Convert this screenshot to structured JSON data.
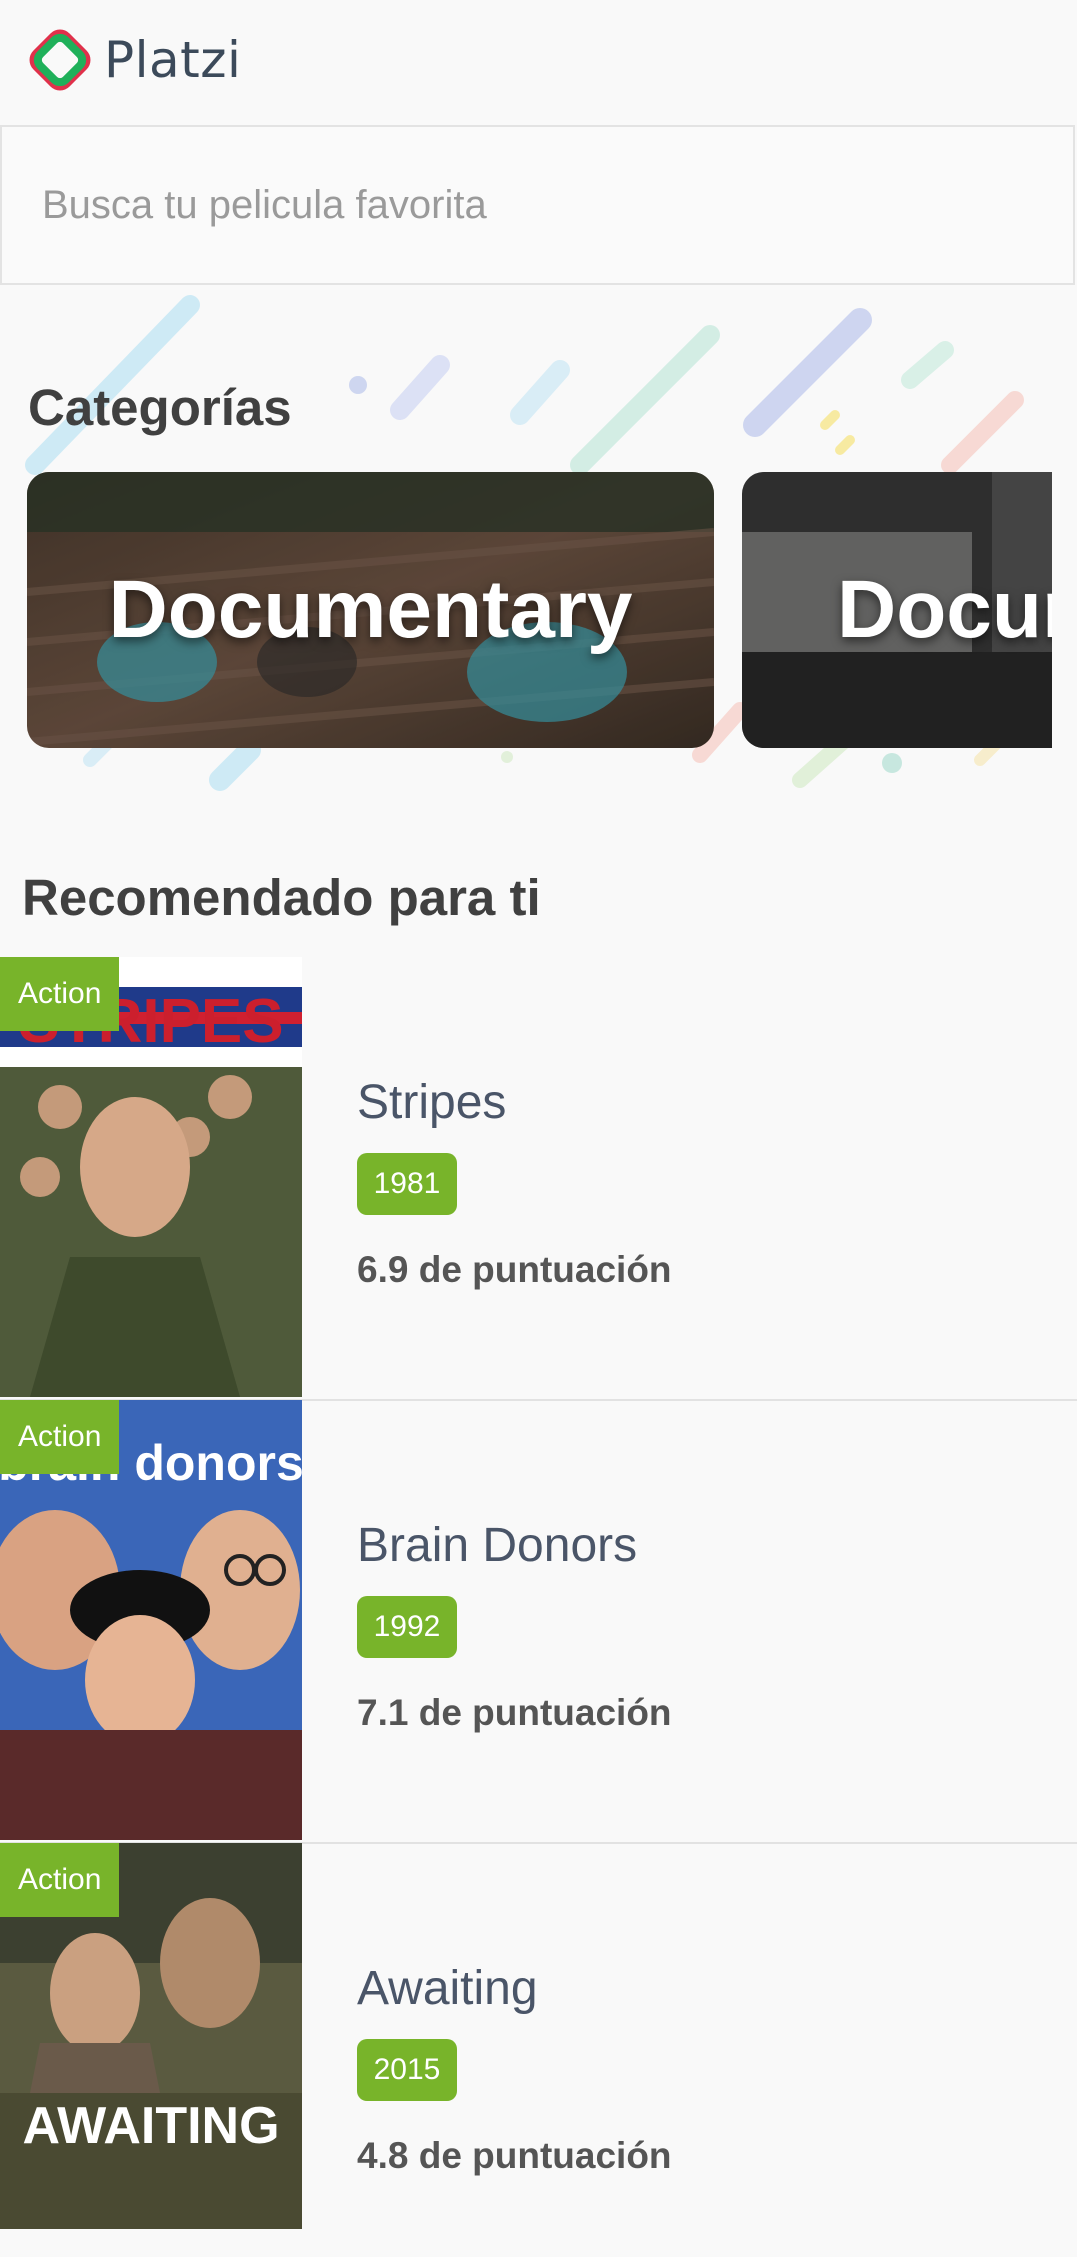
{
  "header": {
    "brand": "Platzi"
  },
  "search": {
    "placeholder": "Busca tu pelicula favorita"
  },
  "categories": {
    "title": "Categorías",
    "items": [
      {
        "label": "Documentary"
      },
      {
        "label": "Docur"
      }
    ]
  },
  "recommended": {
    "title": "Recomendado para ti",
    "movies": [
      {
        "genre": "Action",
        "title": "Stripes",
        "year": "1981",
        "score": "6.9 de puntuación",
        "poster_text": "STRIPES"
      },
      {
        "genre": "Action",
        "title": "Brain Donors",
        "year": "1992",
        "score": "7.1 de puntuación",
        "poster_text": "brain donors"
      },
      {
        "genre": "Action",
        "title": "Awaiting",
        "year": "2015",
        "score": "4.8 de puntuación",
        "poster_text": "AWAITING"
      }
    ]
  },
  "colors": {
    "accent": "#78b42a",
    "text": "#404040",
    "title": "#4a5568"
  }
}
